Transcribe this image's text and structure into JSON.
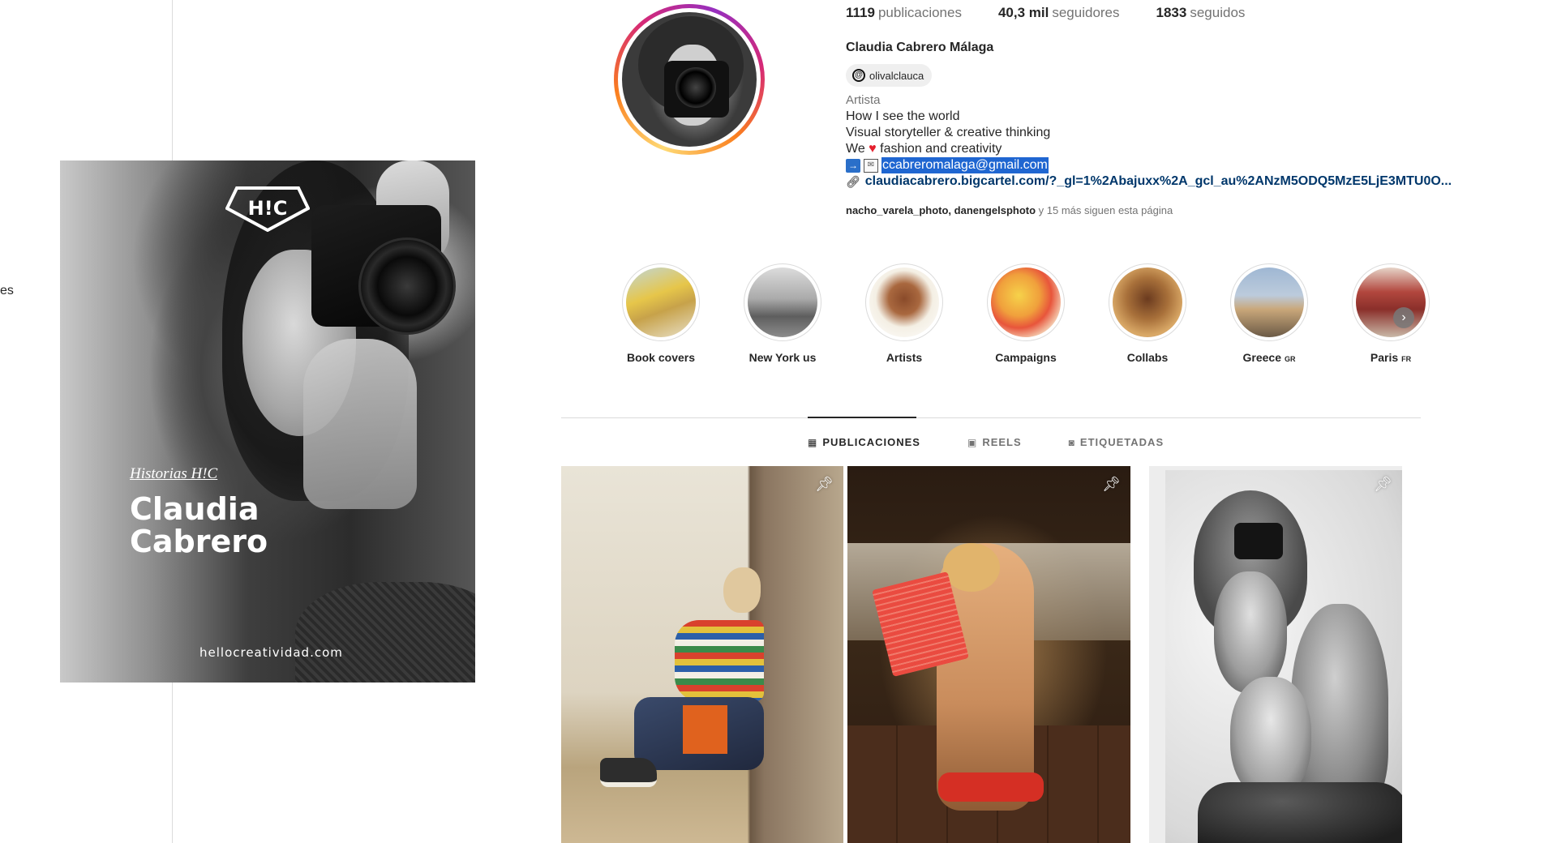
{
  "sidebar": {
    "fragment": "es"
  },
  "promo": {
    "logo": "H!C",
    "series": "Historias H!C",
    "name_line1": "Claudia",
    "name_line2": "Cabrero",
    "site": "hellocreatividad.com"
  },
  "profile": {
    "stats": [
      {
        "value": "1119",
        "label": "publicaciones"
      },
      {
        "value": "40,3 mil",
        "label": "seguidores"
      },
      {
        "value": "1833",
        "label": "seguidos"
      }
    ],
    "full_name": "Claudia Cabrero Málaga",
    "threads_handle": "olivalclauca",
    "category": "Artista",
    "bio_line1": "How I see the world",
    "bio_line2": "Visual storyteller & creative thinking",
    "bio_line3_pre": "We",
    "bio_line3_post": "fashion and creativity",
    "email": "ccabreromalaga@gmail.com",
    "link": "claudiacabrero.bigcartel.com/?_gl=1%2Abajuxx%2A_gcl_au%2ANzM5ODQ5MzE5LjE3MTU0O...",
    "followed_by_names": "nacho_varela_photo, danengelsphoto",
    "followed_by_rest": "y 15 más siguen esta página"
  },
  "highlights": [
    {
      "label": "Book covers",
      "flag": ""
    },
    {
      "label": "New York us",
      "flag": ""
    },
    {
      "label": "Artists",
      "flag": ""
    },
    {
      "label": "Campaigns",
      "flag": ""
    },
    {
      "label": "Collabs",
      "flag": ""
    },
    {
      "label": "Greece",
      "flag": "GR"
    },
    {
      "label": "Paris",
      "flag": "FR"
    }
  ],
  "tabs": [
    {
      "label": "PUBLICACIONES"
    },
    {
      "label": "REELS"
    },
    {
      "label": "ETIQUETADAS"
    }
  ],
  "colors": {
    "selection": "#1f66d1",
    "link": "#00376b",
    "heart": "#e41f2d"
  }
}
